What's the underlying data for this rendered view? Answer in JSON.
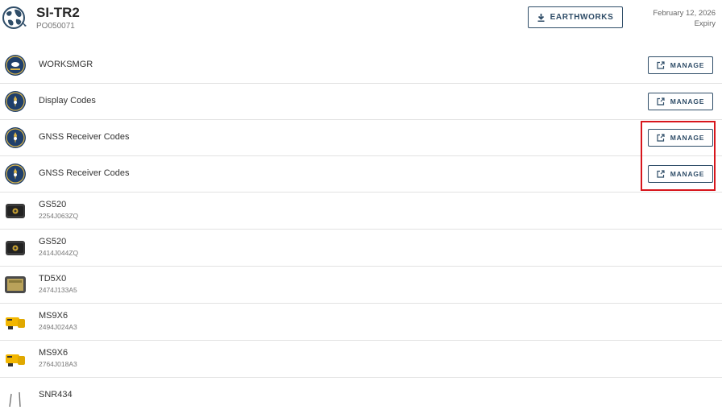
{
  "header": {
    "title": "SI-TR2",
    "subtitle": "PO050071",
    "earthworks_label": "EARTHWORKS",
    "expiry_date": "February 12, 2026",
    "expiry_label": "Expiry"
  },
  "manage_label": "MANAGE",
  "items": [
    {
      "name": "WORKSMGR",
      "icon": "license-badge-icon"
    },
    {
      "name": "Display Codes",
      "icon": "license-badge-icon"
    },
    {
      "name": "GNSS Receiver Codes",
      "icon": "license-badge-icon"
    },
    {
      "name": "GNSS Receiver Codes",
      "icon": "license-badge-icon"
    },
    {
      "name": "GS520",
      "serial": "2254J063ZQ",
      "icon": "gnss-receiver-icon"
    },
    {
      "name": "GS520",
      "serial": "2414J044ZQ",
      "icon": "gnss-receiver-icon"
    },
    {
      "name": "TD5X0",
      "serial": "2474J133A5",
      "icon": "display-unit-icon"
    },
    {
      "name": "MS9X6",
      "serial": "2494J024A3",
      "icon": "machine-sensor-icon"
    },
    {
      "name": "MS9X6",
      "serial": "2764J018A3",
      "icon": "machine-sensor-icon"
    },
    {
      "name": "SNR434",
      "icon": "antenna-icon"
    }
  ],
  "colors": {
    "accent": "#2f4d68",
    "highlight": "#d7161c",
    "divider": "#e2e2e2"
  }
}
